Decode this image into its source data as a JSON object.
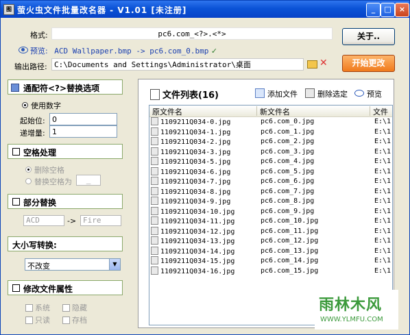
{
  "window": {
    "title": "萤火虫文件批量改名器 - V1.01 [未注册]",
    "app_icon": "图"
  },
  "header": {
    "format_label": "格式:",
    "format_value": "pc6.com_<?>.<*>",
    "preview_label": "预览:",
    "preview_value": "ACD Wallpaper.bmp -> pc6.com_0.bmp",
    "output_label": "输出路径:",
    "output_value": "C:\\Documents and Settings\\Administrator\\桌面",
    "about_button": "关于..",
    "start_button": "开始更改"
  },
  "wildcard": {
    "title": "通配符<?>替换选项",
    "use_number": "使用数字",
    "start_label": "起始位:",
    "start_value": "0",
    "step_label": "递增量:",
    "step_value": "1"
  },
  "space": {
    "title": "空格处理",
    "delete": "删除空格",
    "replace": "替换空格为",
    "replace_value": "_"
  },
  "partial": {
    "title": "部分替换",
    "from": "ACD",
    "arrow": "->",
    "to": "Fire"
  },
  "case": {
    "title": "大小写转换:",
    "selected": "不改变"
  },
  "attributes": {
    "title": "修改文件属性",
    "system": "系统",
    "hidden": "隐藏",
    "readonly": "只读",
    "archive": "存档"
  },
  "filelist": {
    "title": "文件列表(16)",
    "add": "添加文件",
    "remove": "删除选定",
    "preview": "预览",
    "col_original": "原文件名",
    "col_new": "新文件名",
    "col_path": "文件",
    "rows": [
      {
        "orig": "1109211Q034-0.jpg",
        "new": "pc6.com_0.jpg",
        "path": "E:\\1"
      },
      {
        "orig": "1109211Q034-1.jpg",
        "new": "pc6.com_1.jpg",
        "path": "E:\\1"
      },
      {
        "orig": "1109211Q034-2.jpg",
        "new": "pc6.com_2.jpg",
        "path": "E:\\1"
      },
      {
        "orig": "1109211Q034-3.jpg",
        "new": "pc6.com_3.jpg",
        "path": "E:\\1"
      },
      {
        "orig": "1109211Q034-5.jpg",
        "new": "pc6.com_4.jpg",
        "path": "E:\\1"
      },
      {
        "orig": "1109211Q034-6.jpg",
        "new": "pc6.com_5.jpg",
        "path": "E:\\1"
      },
      {
        "orig": "1109211Q034-7.jpg",
        "new": "pc6.com_6.jpg",
        "path": "E:\\1"
      },
      {
        "orig": "1109211Q034-8.jpg",
        "new": "pc6.com_7.jpg",
        "path": "E:\\1"
      },
      {
        "orig": "1109211Q034-9.jpg",
        "new": "pc6.com_8.jpg",
        "path": "E:\\1"
      },
      {
        "orig": "1109211Q034-10.jpg",
        "new": "pc6.com_9.jpg",
        "path": "E:\\1"
      },
      {
        "orig": "1109211Q034-11.jpg",
        "new": "pc6.com_10.jpg",
        "path": "E:\\1"
      },
      {
        "orig": "1109211Q034-12.jpg",
        "new": "pc6.com_11.jpg",
        "path": "E:\\1"
      },
      {
        "orig": "1109211Q034-13.jpg",
        "new": "pc6.com_12.jpg",
        "path": "E:\\1"
      },
      {
        "orig": "1109211Q034-14.jpg",
        "new": "pc6.com_13.jpg",
        "path": "E:\\1"
      },
      {
        "orig": "1109211Q034-15.jpg",
        "new": "pc6.com_14.jpg",
        "path": "E:\\1"
      },
      {
        "orig": "1109211Q034-16.jpg",
        "new": "pc6.com_15.jpg",
        "path": "E:\\1"
      }
    ]
  },
  "watermark": {
    "text": "雨林木风",
    "url": "WWW.YLMFU.COM"
  },
  "colors": {
    "titlebar": "#0b53d6",
    "start_button": "#f07a1c",
    "section_border": "#8aa86a",
    "preview_link": "#1a3fb0"
  }
}
